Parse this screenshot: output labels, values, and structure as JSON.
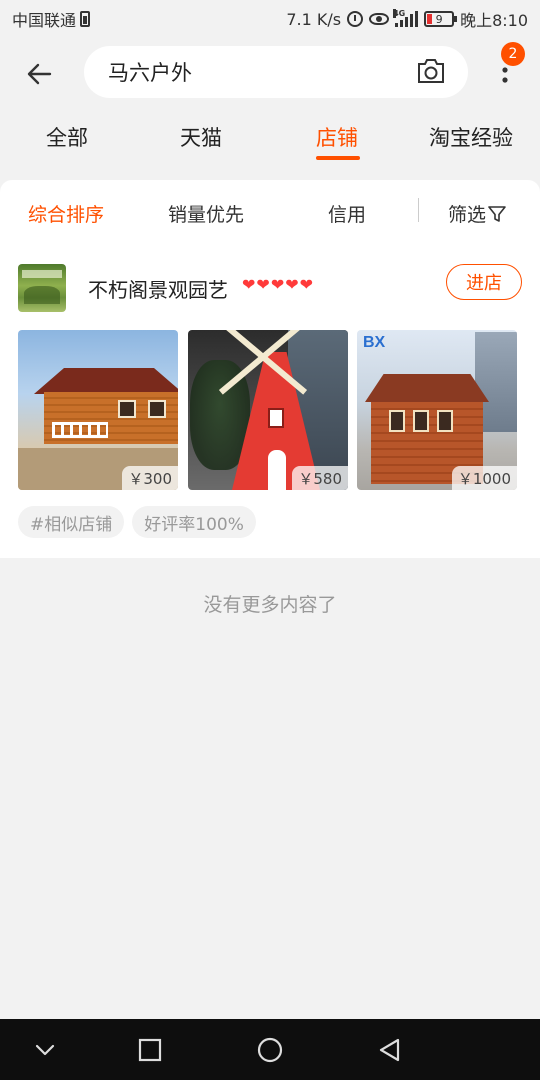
{
  "status_bar": {
    "carrier": "中国联通",
    "speed": "7.1 K/s",
    "network": "4G",
    "battery": "9",
    "time": "晚上8:10"
  },
  "header": {
    "search_text": "马六户外",
    "notification_count": "2"
  },
  "tabs": [
    {
      "label": "全部",
      "active": false
    },
    {
      "label": "天猫",
      "active": false
    },
    {
      "label": "店铺",
      "active": true
    },
    {
      "label": "淘宝经验",
      "active": false
    }
  ],
  "sort_bar": {
    "items": [
      "综合排序",
      "销量优先",
      "信用"
    ],
    "filter_label": "筛选"
  },
  "shop": {
    "name": "不朽阁景观园艺",
    "hearts": 5,
    "enter_label": "进店",
    "products": [
      {
        "price": "￥300",
        "image": "wooden-cabin"
      },
      {
        "price": "￥580",
        "image": "red-windmill"
      },
      {
        "price": "￥1000",
        "image": "wooden-kiosk"
      }
    ],
    "tags": [
      "#相似店铺",
      "好评率100%"
    ]
  },
  "footer": {
    "no_more": "没有更多内容了"
  },
  "colors": {
    "accent": "#ff5000",
    "background": "#f2f2f2"
  }
}
